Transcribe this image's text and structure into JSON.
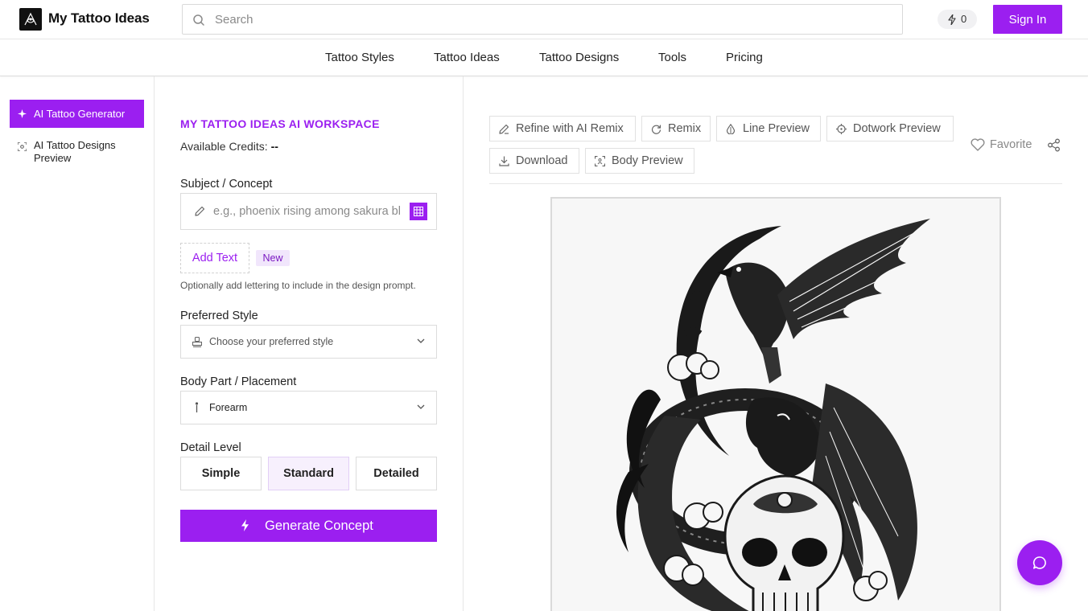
{
  "header": {
    "brand": "My Tattoo Ideas",
    "search_placeholder": "Search",
    "credits_count": "0",
    "signin_label": "Sign In"
  },
  "nav": {
    "items": [
      "Tattoo Styles",
      "Tattoo Ideas",
      "Tattoo Designs",
      "Tools",
      "Pricing"
    ]
  },
  "sidebar": {
    "items": [
      {
        "label": "AI Tattoo Generator",
        "active": true,
        "icon": "sparkle-icon"
      },
      {
        "label": "AI Tattoo Designs Preview",
        "active": false,
        "icon": "scan-icon"
      }
    ]
  },
  "form": {
    "workspace_title": "MY TATTOO IDEAS AI WORKSPACE",
    "available_credits_label": "Available Credits:",
    "available_credits_value": "--",
    "subject_label": "Subject / Concept",
    "subject_placeholder": "e.g., phoenix rising among sakura blossoms",
    "add_text_label": "Add Text",
    "new_badge": "New",
    "add_text_hint": "Optionally add lettering to include in the design prompt.",
    "style_label": "Preferred Style",
    "style_value": "Choose your preferred style",
    "placement_label": "Body Part / Placement",
    "placement_value": "Forearm",
    "detail_label": "Detail Level",
    "detail_options": [
      "Simple",
      "Standard",
      "Detailed"
    ],
    "detail_selected": "Standard",
    "generate_label": "Generate Concept"
  },
  "preview": {
    "tools": [
      {
        "label": "Refine with AI Remix",
        "icon": "pencil-icon"
      },
      {
        "label": "Remix",
        "icon": "refresh-icon"
      },
      {
        "label": "Line Preview",
        "icon": "drop-icon"
      },
      {
        "label": "Dotwork Preview",
        "icon": "crosshair-icon"
      },
      {
        "label": "Download",
        "icon": "download-icon"
      },
      {
        "label": "Body Preview",
        "icon": "scan-icon"
      }
    ],
    "favorite_label": "Favorite",
    "image_alt": "black and grey tattoo design: crow on crescent moon over dragon and skull"
  },
  "colors": {
    "accent": "#9b1ff0",
    "badge_bg": "#f1e6fc"
  }
}
